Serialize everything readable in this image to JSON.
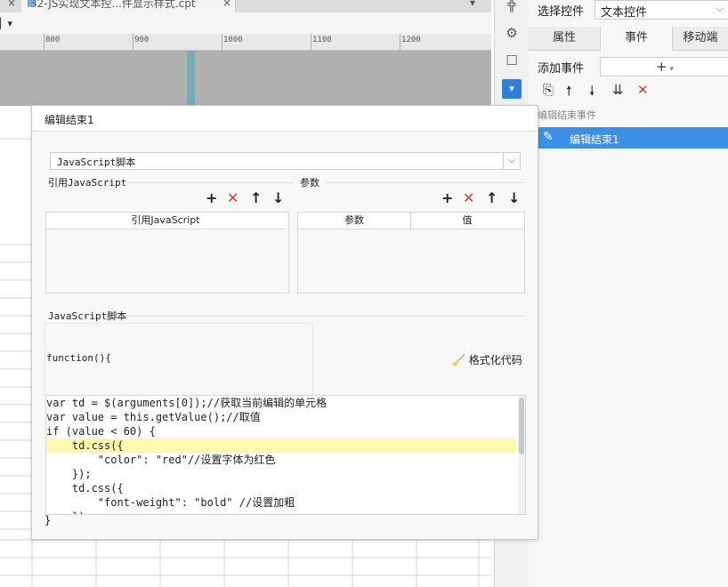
{
  "tabstrip": {
    "doc_tab": "32-JS实现文本控...件显示样式.cpt",
    "close_glyph": "×"
  },
  "ruler": {
    "labels": [
      "800",
      "900",
      "1000",
      "1100",
      "1200"
    ]
  },
  "right_panel": {
    "select_control_label": "选择控件",
    "select_control_value": "文本控件",
    "tabs": [
      "属性",
      "事件",
      "移动端"
    ],
    "add_event_label": "添加事件",
    "add_event_button": "+",
    "event_section_label": "编辑结束事件",
    "event_item": "编辑结束1"
  },
  "dialog": {
    "title": "编辑结束1",
    "script_type": "JavaScript脚本",
    "ref_js_label": "引用JavaScript",
    "params_label": "参数",
    "ref_js_column": "引用JavaScript",
    "params_columns": [
      "参数",
      "值"
    ],
    "script_section_label": "JavaScript脚本",
    "function_open": "function(){",
    "format_code": "格式化代码",
    "function_close": "}",
    "code_lines": [
      "var td = $(arguments[0]);//获取当前编辑的单元格",
      "var value = this.getValue();//取值",
      "if (value < 60) {",
      "    td.css({",
      "        \"color\": \"red\"//设置字体为红色",
      "    });",
      "    td.css({",
      "        \"font-weight\": \"bold\" //设置加粗",
      "    });"
    ]
  },
  "colors": {
    "selection_blue": "#3d8ee6",
    "delete_red": "#e23636",
    "highlight_line": "#fff8b0"
  }
}
